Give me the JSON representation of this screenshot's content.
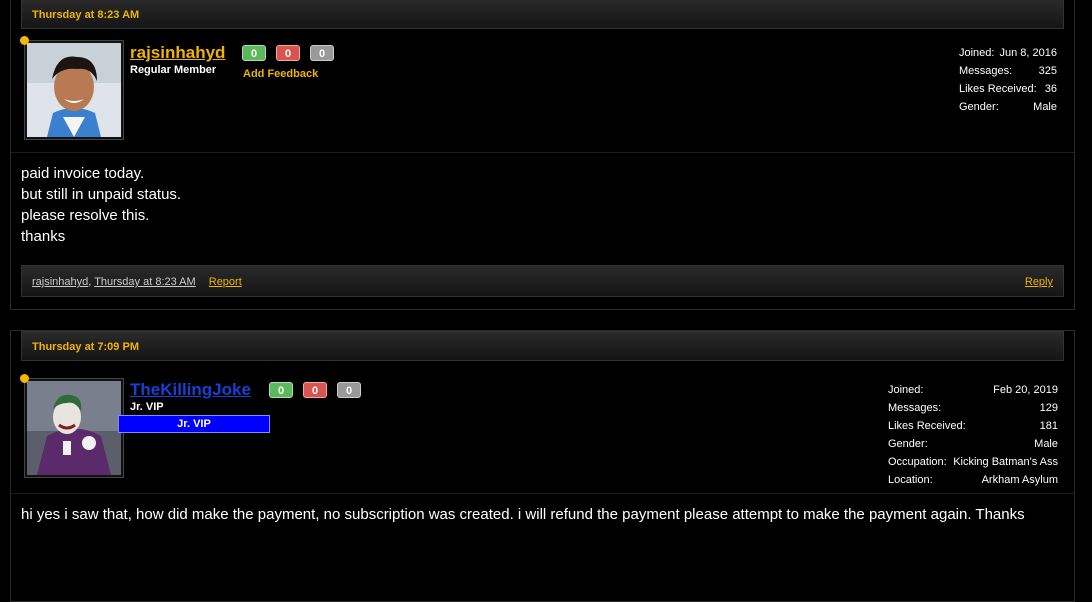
{
  "posts": [
    {
      "header": "Thursday at 8:23 AM",
      "username": "rajsinhahyd",
      "username_color": "#f0b400",
      "user_title": "Regular Member",
      "feedback": {
        "positive": "0",
        "negative": "0",
        "neutral": "0"
      },
      "add_feedback": "Add Feedback",
      "stats": [
        {
          "label": "Joined:",
          "value": "Jun 8, 2016"
        },
        {
          "label": "Messages:",
          "value": "325"
        },
        {
          "label": "Likes Received:",
          "value": "36"
        },
        {
          "label": "Gender:",
          "value": "Male"
        }
      ],
      "message_lines": [
        "paid invoice today.",
        "but still in unpaid status.",
        "please resolve this.",
        "thanks"
      ],
      "footer": {
        "author": "rajsinhahyd",
        "sep": ", ",
        "date": "Thursday at 8:23 AM",
        "report": "Report",
        "reply": "Reply"
      }
    },
    {
      "header": "Thursday at 7:09 PM",
      "username": "TheKillingJoke",
      "username_color": "#1a3fd6",
      "user_title": "Jr. VIP",
      "badge": "Jr. VIP",
      "feedback": {
        "positive": "0",
        "negative": "0",
        "neutral": "0"
      },
      "stats": [
        {
          "label": "Joined:",
          "value": "Feb 20, 2019"
        },
        {
          "label": "Messages:",
          "value": "129"
        },
        {
          "label": "Likes Received:",
          "value": "181"
        },
        {
          "label": "Gender:",
          "value": "Male"
        },
        {
          "label": "Occupation:",
          "value": "Kicking Batman's Ass"
        },
        {
          "label": "Location:",
          "value": "Arkham Asylum"
        }
      ],
      "message_lines": [
        "hi yes i saw that, how did make the payment, no subscription was created. i will refund the payment please attempt to make the payment again. Thanks"
      ]
    }
  ]
}
